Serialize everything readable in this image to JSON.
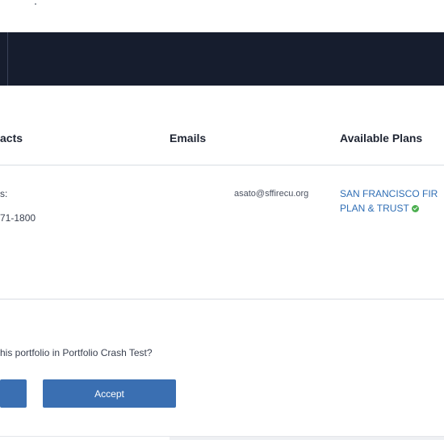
{
  "table": {
    "headers": {
      "contacts": "acts",
      "emails": "Emails",
      "plans": "Available Plans"
    },
    "row": {
      "contact_label": "s:",
      "contact_phone": "71-1800",
      "email": "asato@sffirecu.org",
      "plan_line1": "SAN FRANCISCO FIR",
      "plan_line2": "PLAN & TRUST"
    }
  },
  "prompt": {
    "question": "his portfolio in Portfolio Crash Test?"
  },
  "buttons": {
    "left_label": "",
    "accept_label": "Accept"
  },
  "colors": {
    "navbar": "#161d2e",
    "button": "#3a6fb2",
    "link": "#2f6eb5",
    "check": "#4caf50"
  }
}
